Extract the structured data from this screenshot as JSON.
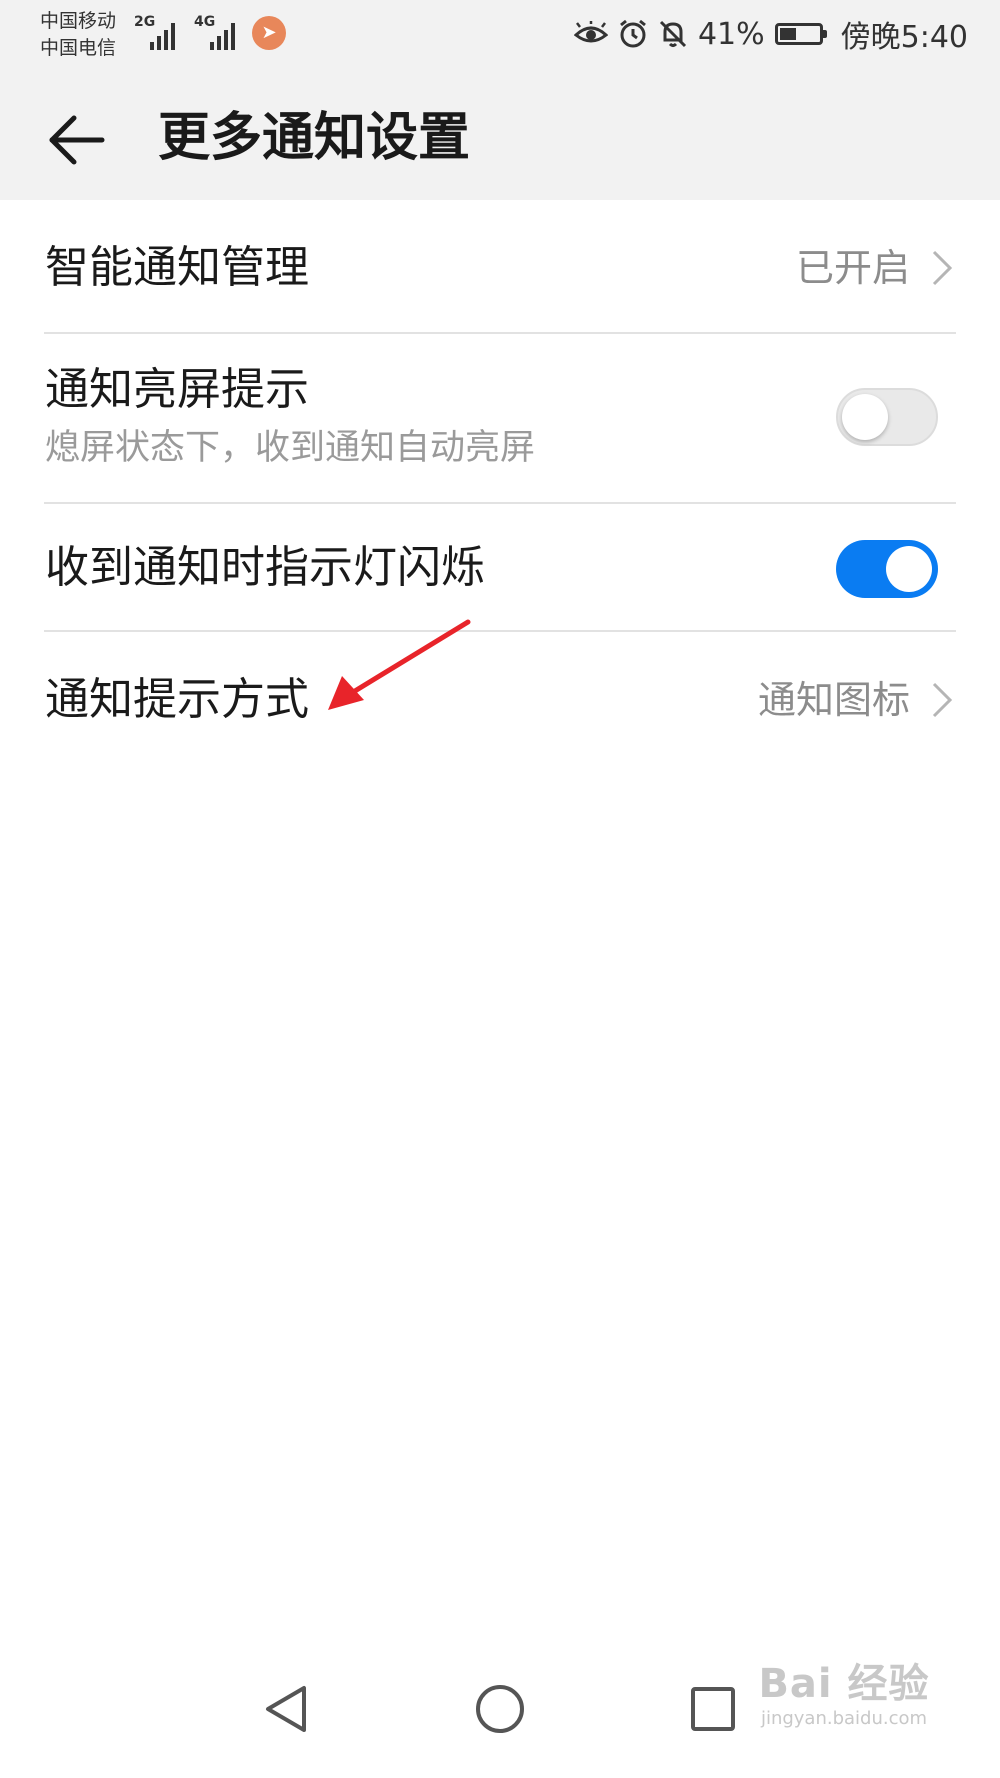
{
  "status_bar": {
    "carrier_1": "中国移动",
    "carrier_2": "中国电信",
    "network_1": "2G",
    "network_2": "4G",
    "battery_percent": "41%",
    "battery_level": 0.41,
    "time": "傍晚5:40",
    "icons": [
      "eye-comfort-icon",
      "alarm-icon",
      "notifications-muted-icon"
    ]
  },
  "header": {
    "title": "更多通知设置"
  },
  "settings": [
    {
      "title": "智能通知管理",
      "value": "已开启",
      "type": "link"
    },
    {
      "title": "通知亮屏提示",
      "subtitle": "熄屏状态下，收到通知自动亮屏",
      "type": "toggle",
      "enabled": false
    },
    {
      "title": "收到通知时指示灯闪烁",
      "type": "toggle",
      "enabled": true
    },
    {
      "title": "通知提示方式",
      "value": "通知图标",
      "type": "link"
    }
  ],
  "colors": {
    "accent": "#0a7cf2",
    "annotation": "#e8242a",
    "header_bg": "#f2f2f2"
  },
  "watermark": {
    "brand": "Bai 经验",
    "url": "jingyan.baidu.com"
  }
}
